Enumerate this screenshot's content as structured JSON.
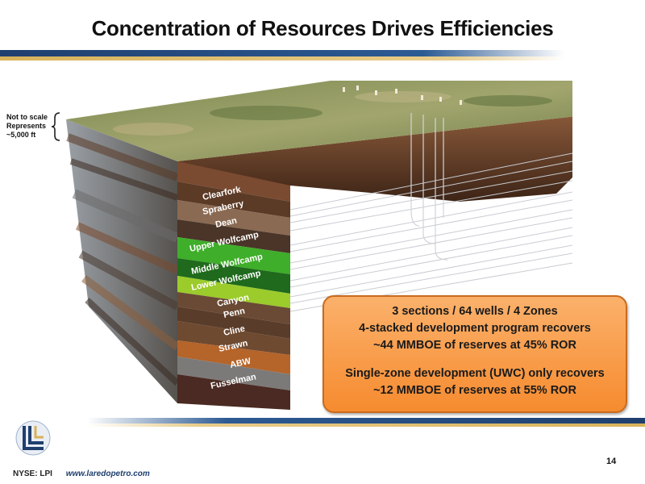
{
  "title": "Concentration of Resources Drives Efficiencies",
  "scale_note": [
    "Not to scale",
    "Represents",
    "~5,000 ft"
  ],
  "zones": [
    {
      "label": "Clearfork"
    },
    {
      "label": "Spraberry"
    },
    {
      "label": "Dean"
    },
    {
      "label": "Upper Wolfcamp",
      "color": "#3fae2a"
    },
    {
      "label": "Middle Wolfcamp",
      "color": "#1f6a1c"
    },
    {
      "label": "Lower Wolfcamp",
      "color": "#9ccb2c"
    },
    {
      "label": "Canyon"
    },
    {
      "label": "Penn"
    },
    {
      "label": "Cline"
    },
    {
      "label": "Strawn"
    },
    {
      "label": "ABW"
    },
    {
      "label": "Fusselman"
    }
  ],
  "info_box": {
    "lines": [
      "3 sections / 64 wells / 4 Zones",
      "4-stacked development program recovers",
      "~44 MMBOE of reserves at 45% ROR",
      "Single-zone development (UWC) only recovers",
      "~12 MMBOE of reserves at 55% ROR"
    ],
    "color": "#f7953a"
  },
  "page_number": "14",
  "footer": {
    "ticker": "NYSE: LPI",
    "url": "www.laredopetro.com"
  },
  "colors": {
    "navy": "#1f3f6e",
    "gold": "#d8b25a"
  }
}
